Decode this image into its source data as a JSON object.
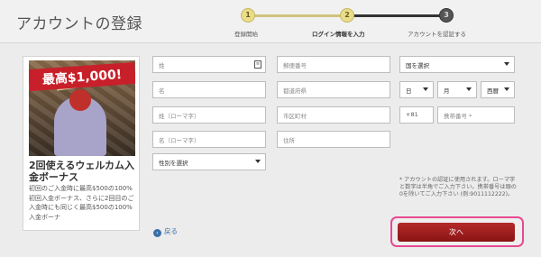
{
  "header": {
    "title": "アカウントの登録"
  },
  "stepper": {
    "steps": [
      {
        "number": "1",
        "label": "登録開始"
      },
      {
        "number": "2",
        "label": "ログイン情報を入力"
      },
      {
        "number": "3",
        "label": "アカウントを認証する"
      }
    ],
    "current_step": 2
  },
  "promo": {
    "amount_banner": "最高$1,000!",
    "heading": "2回使えるウェルカム入金ボーナス",
    "body": "初回のご入金時に最高$500の100%初回入金ボーナス、さらに2回目のご入金時にも同じく最高$500の100%入金ボーナ"
  },
  "form": {
    "col1": {
      "last_name": "姓",
      "first_name": "名",
      "last_name_roman": "姓（ローマ字）",
      "first_name_roman": "名（ローマ字）",
      "gender_select": "性別を選択"
    },
    "col2": {
      "postal_code": "郵便番号",
      "prefecture": "都道府県",
      "city": "市区町村",
      "address": "住所"
    },
    "col3": {
      "country_select": "国を選択",
      "day_select": "日",
      "month_select": "月",
      "year_select": "西暦",
      "phone_code": "+81",
      "phone_number": "携帯番号 *"
    },
    "card_icon": "id-card-icon",
    "note": "* アカウントの認証に使用されます。ローマ字と数字は半角でご入力下さい。携帯番号は頭の0を除いてご入力下さい (例:9011112222)。"
  },
  "actions": {
    "back_label": "戻る",
    "next_label": "次へ"
  },
  "colors": {
    "accent_red": "#9e1f1f",
    "highlight_pink": "#e8498f",
    "step_gold": "#e9dd8a",
    "link_blue": "#3a6fa8"
  }
}
